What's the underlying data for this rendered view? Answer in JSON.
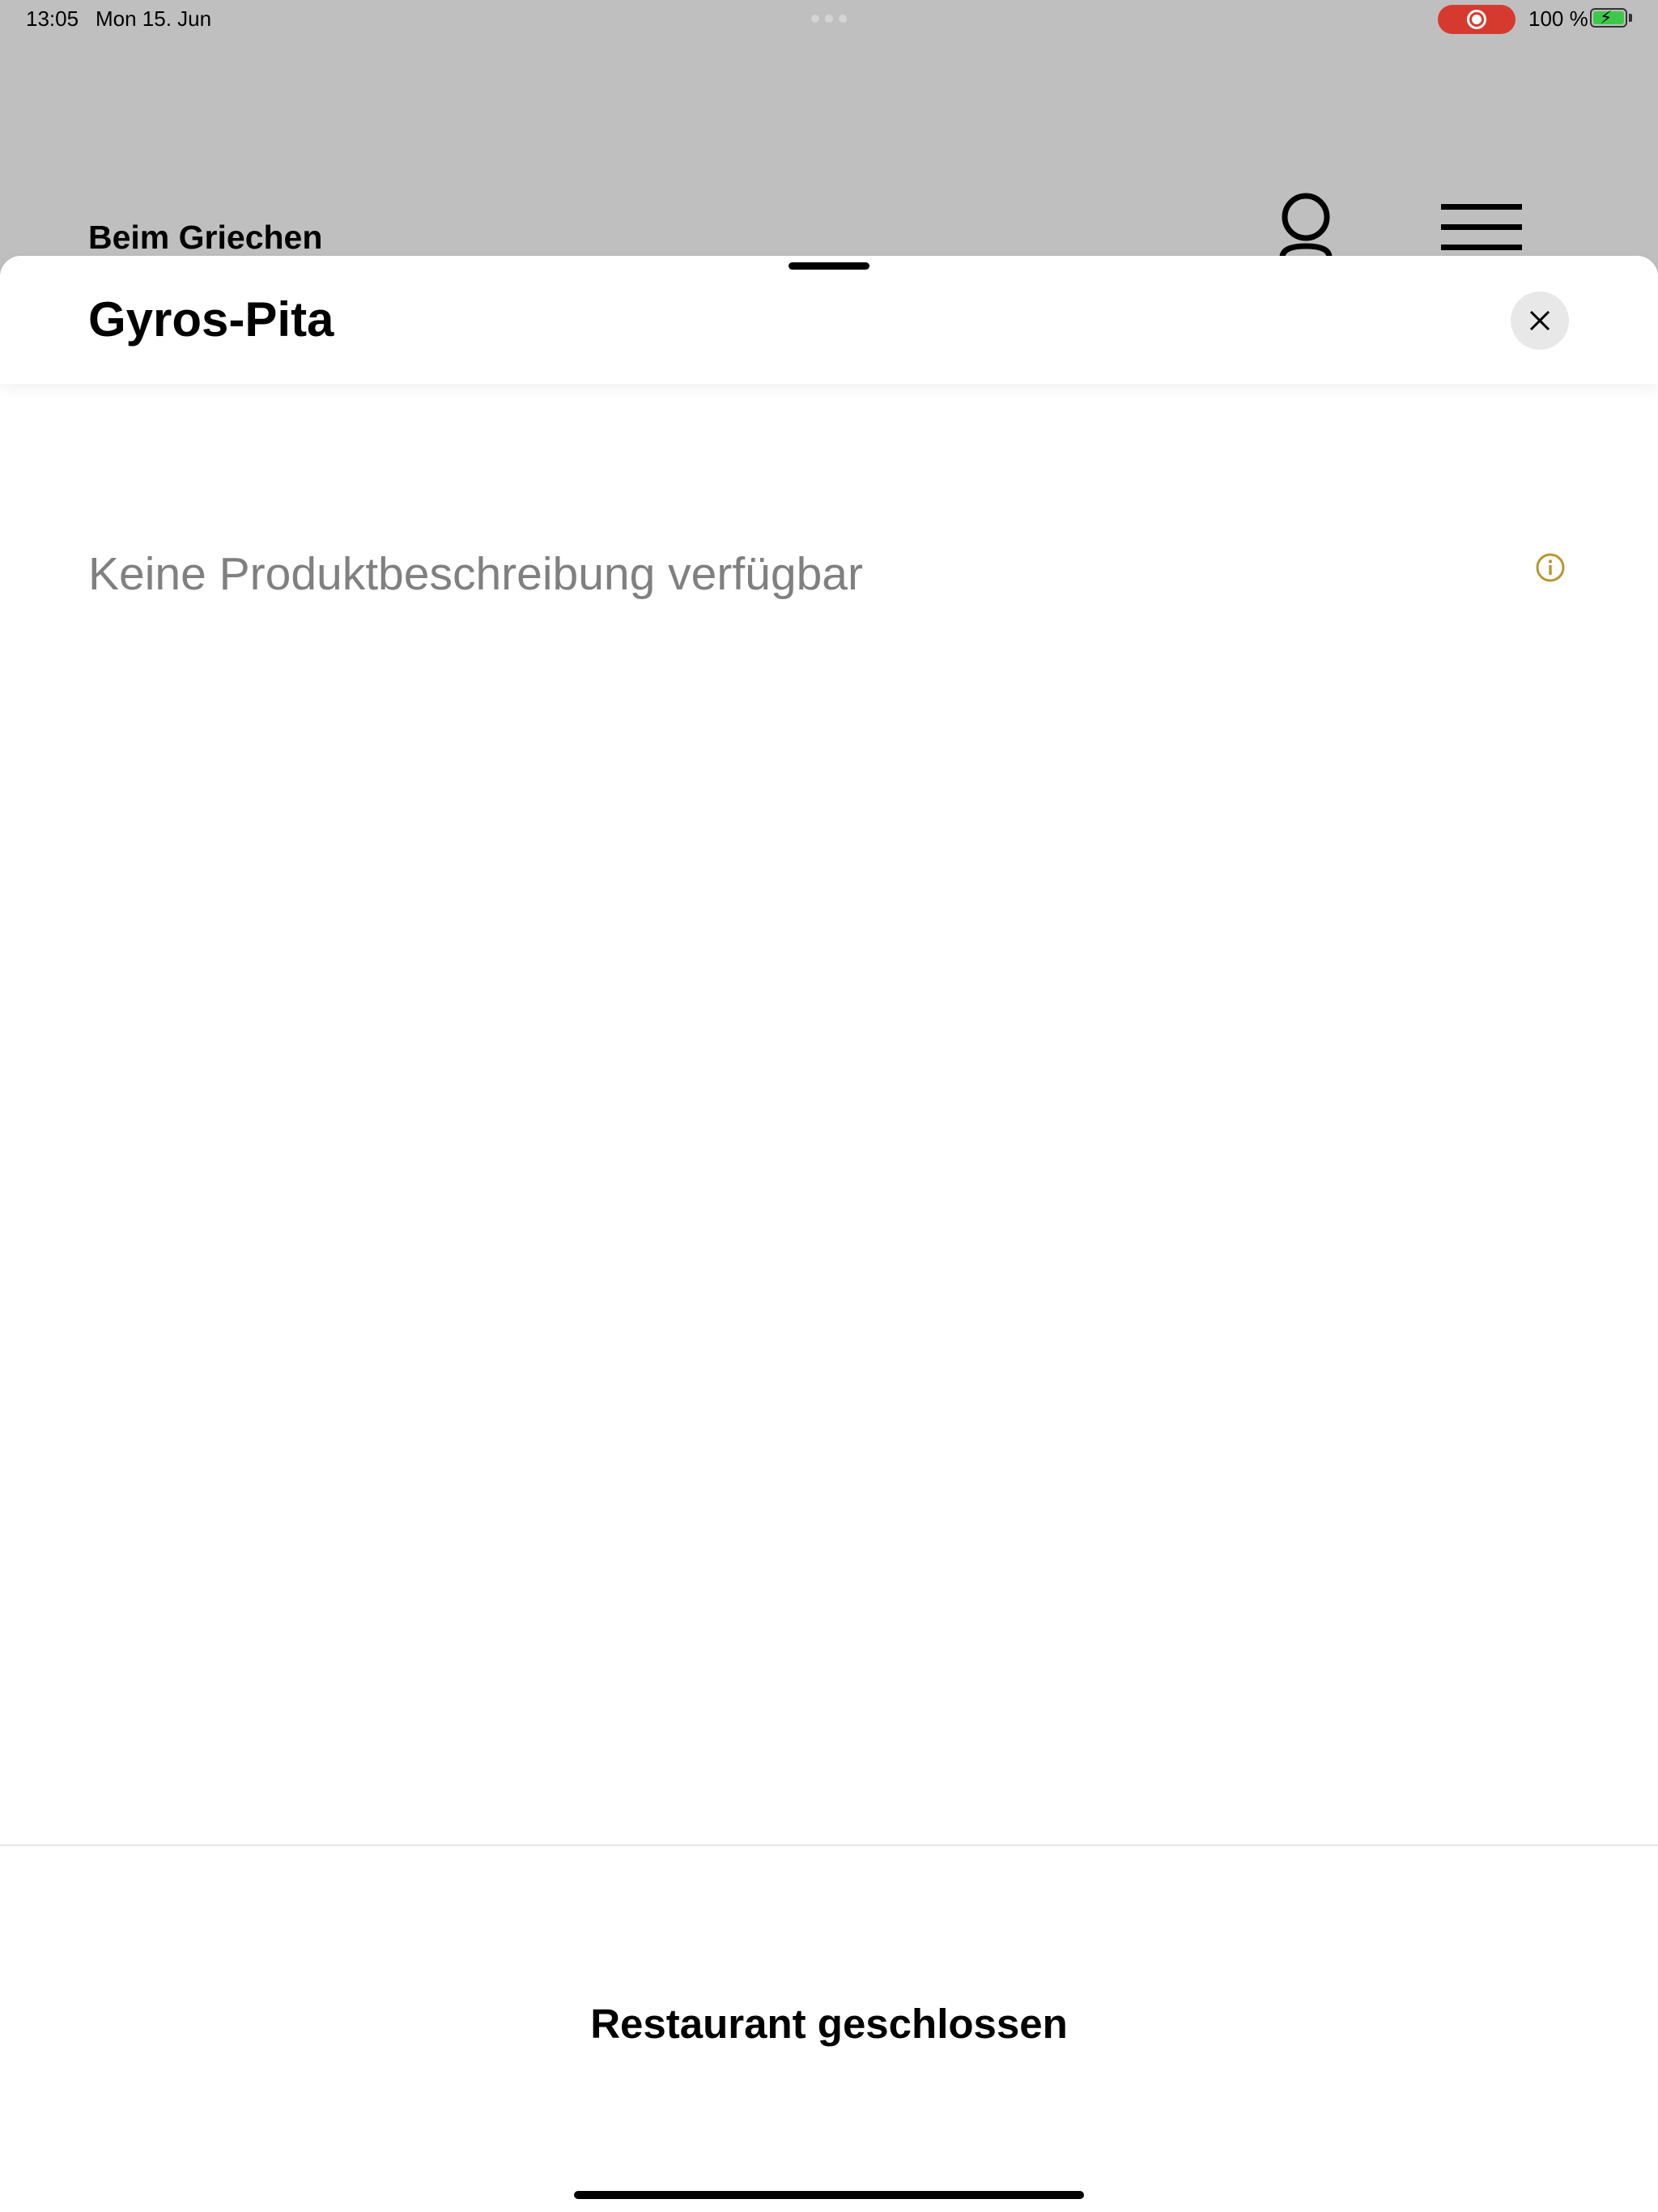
{
  "status_bar": {
    "time": "13:05",
    "date": "Mon 15. Jun",
    "battery_percent": "100 %",
    "battery_level": 1.0,
    "recording_color": "#d63a2f",
    "battery_color": "#3ec84a"
  },
  "header": {
    "restaurant_name": "Beim Griechen",
    "user_icon": "user-icon",
    "menu_icon": "hamburger-menu-icon"
  },
  "sheet": {
    "title": "Gyros-Pita",
    "close_icon": "close-icon",
    "description": "Keine Produktbeschreibung verfügbar",
    "info_icon": "info-icon",
    "info_icon_color": "#b8962e",
    "footer_status": "Restaurant geschlossen"
  }
}
